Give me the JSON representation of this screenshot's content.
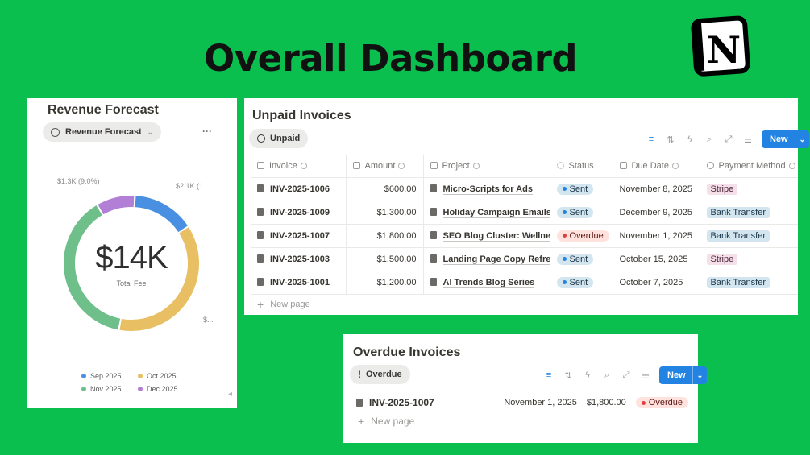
{
  "page_title": "Overall Dashboard",
  "logo_letter": "N",
  "revenue": {
    "title": "Revenue Forecast",
    "view_pill": "Revenue Forecast",
    "more": "···",
    "center_value": "$14K",
    "center_label": "Total Fee",
    "slice_labels": [
      "$1.3K (9.0%)",
      "$2.1K (1...",
      "$..."
    ],
    "legend": [
      {
        "label": "Sep 2025",
        "color": "#4a90e2"
      },
      {
        "label": "Oct 2025",
        "color": "#e8bf63"
      },
      {
        "label": "Nov 2025",
        "color": "#6fbf8a"
      },
      {
        "label": "Dec 2025",
        "color": "#b27fd6"
      }
    ]
  },
  "chart_data": {
    "type": "pie",
    "title": "Revenue Forecast",
    "center_label": "Total Fee",
    "center_value": "$14K",
    "categories": [
      "Sep 2025",
      "Oct 2025",
      "Nov 2025",
      "Dec 2025"
    ],
    "values": [
      2.1,
      5.2,
      5.4,
      1.3
    ],
    "colors": [
      "#4a90e2",
      "#e8bf63",
      "#6fbf8a",
      "#b27fd6"
    ],
    "legend_position": "bottom"
  },
  "unpaid": {
    "title": "Unpaid Invoices",
    "view_pill": "Unpaid",
    "new_label": "New",
    "columns": [
      "Invoice",
      "Amount",
      "Project",
      "Status",
      "Due Date",
      "Payment Method"
    ],
    "rows": [
      {
        "invoice": "INV-2025-1006",
        "amount": "$600.00",
        "project": "Micro-Scripts for Ads",
        "status": "Sent",
        "due": "November 8, 2025",
        "method": "Stripe"
      },
      {
        "invoice": "INV-2025-1009",
        "amount": "$1,300.00",
        "project": "Holiday Campaign Emails",
        "status": "Sent",
        "due": "December 9, 2025",
        "method": "Bank Transfer"
      },
      {
        "invoice": "INV-2025-1007",
        "amount": "$1,800.00",
        "project": "SEO Blog Cluster: Wellness",
        "status": "Overdue",
        "due": "November 1, 2025",
        "method": "Bank Transfer"
      },
      {
        "invoice": "INV-2025-1003",
        "amount": "$1,500.00",
        "project": "Landing Page Copy Refresh",
        "status": "Sent",
        "due": "October 15, 2025",
        "method": "Stripe"
      },
      {
        "invoice": "INV-2025-1001",
        "amount": "$1,200.00",
        "project": "AI Trends Blog Series",
        "status": "Sent",
        "due": "October 7, 2025",
        "method": "Bank Transfer"
      }
    ],
    "new_page": "New page"
  },
  "overdue": {
    "title": "Overdue Invoices",
    "view_pill": "Overdue",
    "new_label": "New",
    "row": {
      "invoice": "INV-2025-1007",
      "due": "November 1, 2025",
      "amount": "$1,800.00",
      "status": "Overdue"
    },
    "new_page": "New page"
  }
}
